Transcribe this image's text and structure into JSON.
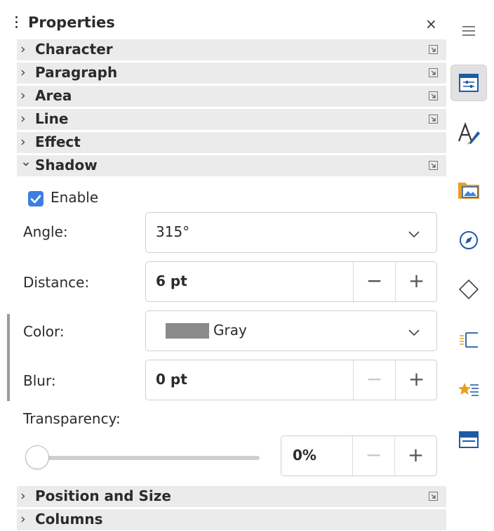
{
  "deck": {
    "title": "Properties",
    "close_glyph": "×"
  },
  "sections_top": [
    {
      "label": "Character",
      "chevron": "›",
      "has_more_button": true
    },
    {
      "label": "Paragraph",
      "chevron": "›",
      "has_more_button": true
    },
    {
      "label": "Area",
      "chevron": "›",
      "has_more_button": true
    },
    {
      "label": "Line",
      "chevron": "›",
      "has_more_button": true
    },
    {
      "label": "Effect",
      "chevron": "›",
      "has_more_button": false
    },
    {
      "label": "Shadow",
      "chevron": "⌄",
      "has_more_button": true,
      "expanded": true
    }
  ],
  "shadow": {
    "enable_label": "Enable",
    "enable_checked": true,
    "angle": {
      "label": "Angle:",
      "value": "315°"
    },
    "distance": {
      "label": "Distance:",
      "value": "6 pt",
      "minus": "−",
      "plus": "+"
    },
    "color": {
      "label": "Color:",
      "value": "Gray",
      "swatch": "#8a8a8a"
    },
    "blur": {
      "label": "Blur:",
      "value": "0 pt",
      "minus": "−",
      "plus": "+",
      "minus_disabled": true
    },
    "transparency": {
      "label": "Transparency:",
      "value": "0%",
      "slider_fraction": 0.0,
      "minus": "−",
      "plus": "+",
      "minus_disabled": true
    }
  },
  "sections_bottom": [
    {
      "label": "Position and Size",
      "chevron": "›",
      "has_more_button": true
    },
    {
      "label": "Columns",
      "chevron": "›",
      "has_more_button": false
    }
  ],
  "tabbar": [
    {
      "name": "menu-icon",
      "active": false
    },
    {
      "name": "properties-icon",
      "active": true
    },
    {
      "name": "styles-icon",
      "active": false
    },
    {
      "name": "gallery-icon",
      "active": false
    },
    {
      "name": "navigator-icon",
      "active": false
    },
    {
      "name": "shapes-icon",
      "active": false
    },
    {
      "name": "animation-icon",
      "active": false
    },
    {
      "name": "slide-transition-icon",
      "active": false
    },
    {
      "name": "master-slides-icon",
      "active": false
    }
  ],
  "colors": {
    "accent": "#3d7fe0",
    "section_bg": "#ebebeb",
    "icon_blue": "#1f5aa6",
    "icon_orange": "#e8a020"
  }
}
